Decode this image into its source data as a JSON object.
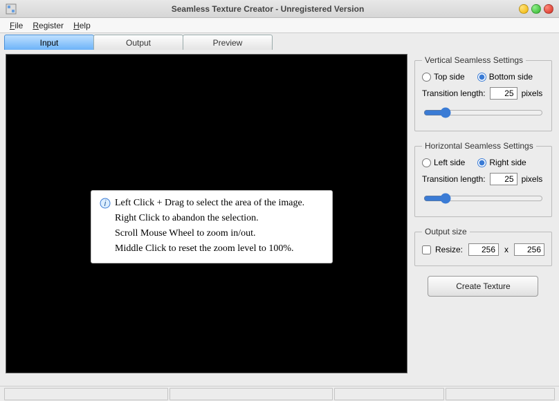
{
  "window": {
    "title": "Seamless Texture Creator - Unregistered Version"
  },
  "menu": {
    "file": "File",
    "register": "Register",
    "help": "Help"
  },
  "tabs": {
    "input": "Input",
    "output": "Output",
    "preview": "Preview"
  },
  "hint": {
    "line1": "Left Click + Drag to select the area of the image.",
    "line2": "Right Click to abandon the selection.",
    "line3": "Scroll Mouse Wheel to zoom in/out.",
    "line4": "Middle Click to reset the zoom level to 100%."
  },
  "vertical": {
    "legend": "Vertical Seamless Settings",
    "opt_top": "Top side",
    "opt_bottom": "Bottom side",
    "trans_label": "Transition length:",
    "trans_value": "25",
    "trans_unit": "pixels",
    "slider_value": 15
  },
  "horizontal": {
    "legend": "Horizontal Seamless Settings",
    "opt_left": "Left side",
    "opt_right": "Right side",
    "trans_label": "Transition length:",
    "trans_value": "25",
    "trans_unit": "pixels",
    "slider_value": 15
  },
  "output": {
    "legend": "Output size",
    "resize_label": "Resize:",
    "width": "256",
    "x": "x",
    "height": "256"
  },
  "create_label": "Create Texture"
}
